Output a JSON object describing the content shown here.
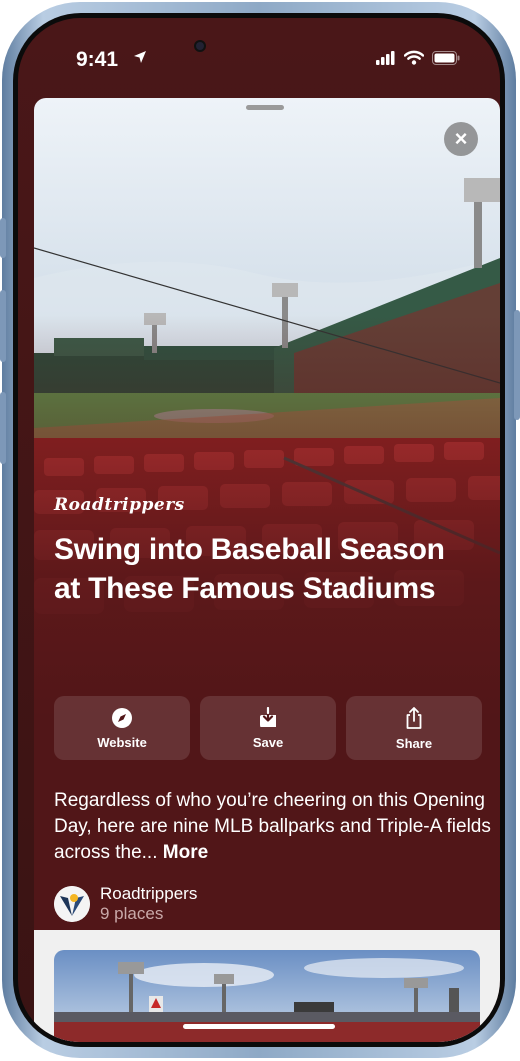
{
  "status_bar": {
    "time": "9:41"
  },
  "card": {
    "brand": "Roadtrippers",
    "title": "Swing into Baseball Season at These Famous Stadiums",
    "actions": [
      {
        "label": "Website",
        "icon": "compass-icon"
      },
      {
        "label": "Save",
        "icon": "save-icon"
      },
      {
        "label": "Share",
        "icon": "share-icon"
      }
    ],
    "description": "Regardless of who you’re cheering on this Opening Day, here are nine MLB ballparks and Triple-A fields across the...",
    "more_label": "More",
    "author": {
      "name": "Roadtrippers",
      "places": "9 places"
    }
  },
  "colors": {
    "card_background": "#511618",
    "accent_text": "#ffffff"
  }
}
